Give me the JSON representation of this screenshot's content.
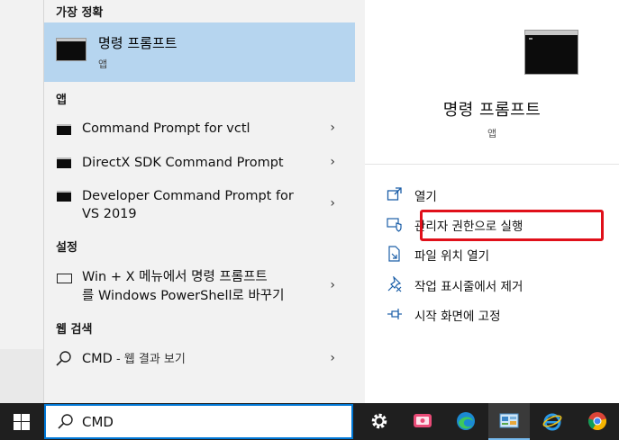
{
  "start_menu": {
    "best_match_header": "가장 정확",
    "best_match": {
      "title": "명령 프롬프트",
      "subtitle": "앱"
    },
    "apps_header": "앱",
    "apps": [
      {
        "label": "Command Prompt for vctl",
        "icon": "cmd-icon"
      },
      {
        "label": "DirectX SDK Command Prompt",
        "icon": "cmd-icon"
      },
      {
        "label_line1": "Developer Command Prompt for",
        "label_line2": "VS 2019",
        "icon": "cmd-icon"
      }
    ],
    "settings_header": "설정",
    "settings": [
      {
        "label_line1": "Win + X 메뉴에서 명령 프롬프트",
        "label_line2": "를 Windows PowerShell로 바꾸기",
        "icon": "monitor-icon"
      }
    ],
    "web_header": "웹 검색",
    "web": [
      {
        "query": "CMD",
        "suffix": " - 웹 결과 보기",
        "icon": "search-icon"
      }
    ],
    "chevron": "›"
  },
  "detail": {
    "title": "명령 프롬프트",
    "subtitle": "앱",
    "actions": [
      {
        "label": "열기",
        "icon": "open-icon"
      },
      {
        "label": "관리자 권한으로 실행",
        "icon": "shield-icon"
      },
      {
        "label": "파일 위치 열기",
        "icon": "file-location-icon"
      },
      {
        "label": "작업 표시줄에서 제거",
        "icon": "unpin-icon"
      },
      {
        "label": "시작 화면에 고정",
        "icon": "pin-icon"
      }
    ],
    "highlight_color": "#e0101a"
  },
  "taskbar": {
    "search_value": "CMD",
    "icons": [
      "windows-start-icon",
      "gear-icon",
      "media-app-icon",
      "edge-icon",
      "control-panel-icon",
      "ie-icon",
      "chrome-icon"
    ],
    "accent": "#0078d7"
  },
  "colors": {
    "selected_bg": "#b6d5ef",
    "menu_bg": "#f2f2f2",
    "taskbar_bg": "#1f1f1f"
  }
}
